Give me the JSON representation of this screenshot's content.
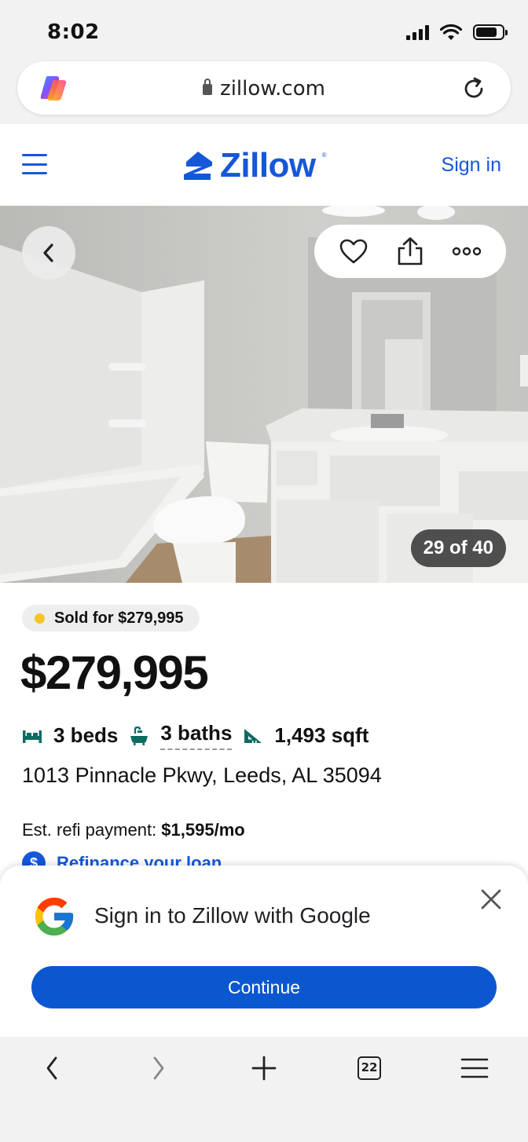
{
  "status_bar": {
    "time": "8:02"
  },
  "browser": {
    "url": "zillow.com"
  },
  "header": {
    "logo_text": "Zillow",
    "sign_in": "Sign in"
  },
  "gallery": {
    "counter": "29 of 40"
  },
  "listing": {
    "status_badge": "Sold for $279,995",
    "price": "$279,995",
    "beds": "3 beds",
    "baths": "3 baths",
    "sqft": "1,493 sqft",
    "address": "1013 Pinnacle Pkwy, Leeds, AL 35094",
    "refi_label": "Est. refi payment: ",
    "refi_value": "$1,595/mo",
    "refi_link": "Refinance your loan"
  },
  "google_sheet": {
    "title": "Sign in to Zillow with Google",
    "continue": "Continue"
  },
  "toolbar": {
    "tabs_count": "22"
  },
  "colors": {
    "zillow_blue": "#1557d8",
    "google_button": "#0b57d0",
    "sold_dot": "#f5c325",
    "icon_teal": "#0e6b62"
  }
}
